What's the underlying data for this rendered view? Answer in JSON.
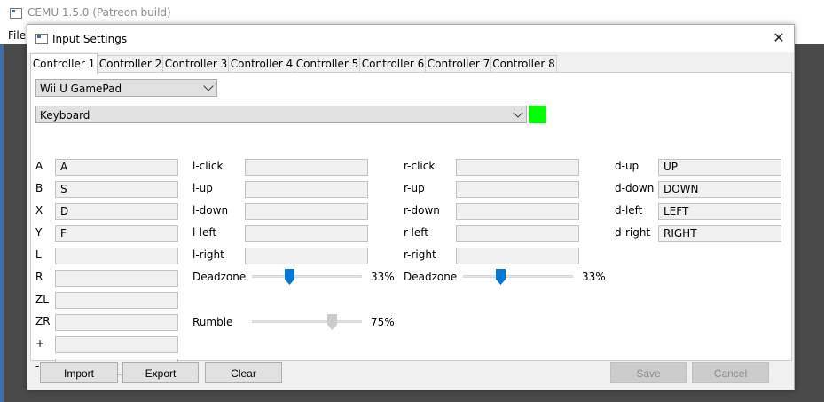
{
  "background_window": {
    "title": "CEMU 1.5.0 (Patreon build)",
    "menu_file": "File"
  },
  "dialog": {
    "title": "Input Settings",
    "close_glyph": "✕"
  },
  "tabs": [
    "Controller 1",
    "Controller 2",
    "Controller 3",
    "Controller 4",
    "Controller 5",
    "Controller 6",
    "Controller 7",
    "Controller 8"
  ],
  "active_tab": 0,
  "controller_type": "Wii U GamePad",
  "input_device": "Keyboard",
  "device_color": "#00ff00",
  "buttons": [
    {
      "label": "A",
      "value": "A"
    },
    {
      "label": "B",
      "value": "S"
    },
    {
      "label": "X",
      "value": "D"
    },
    {
      "label": "Y",
      "value": "F"
    },
    {
      "label": "L",
      "value": ""
    },
    {
      "label": "R",
      "value": ""
    },
    {
      "label": "ZL",
      "value": ""
    },
    {
      "label": "ZR",
      "value": ""
    },
    {
      "label": "+",
      "value": ""
    },
    {
      "label": "-",
      "value": ""
    }
  ],
  "left_stick": [
    {
      "label": "l-click",
      "value": ""
    },
    {
      "label": "l-up",
      "value": ""
    },
    {
      "label": "l-down",
      "value": ""
    },
    {
      "label": "l-left",
      "value": ""
    },
    {
      "label": "l-right",
      "value": ""
    }
  ],
  "right_stick": [
    {
      "label": "r-click",
      "value": ""
    },
    {
      "label": "r-up",
      "value": ""
    },
    {
      "label": "r-down",
      "value": ""
    },
    {
      "label": "r-left",
      "value": ""
    },
    {
      "label": "r-right",
      "value": ""
    }
  ],
  "dpad": [
    {
      "label": "d-up",
      "value": "UP"
    },
    {
      "label": "d-down",
      "value": "DOWN"
    },
    {
      "label": "d-left",
      "value": "LEFT"
    },
    {
      "label": "d-right",
      "value": "RIGHT"
    }
  ],
  "left_deadzone": {
    "label": "Deadzone",
    "value_text": "33%",
    "fraction": 0.33
  },
  "right_deadzone": {
    "label": "Deadzone",
    "value_text": "33%",
    "fraction": 0.33
  },
  "rumble": {
    "label": "Rumble",
    "value_text": "75%",
    "fraction": 0.75
  },
  "footer": {
    "import_label": "Import",
    "export_label": "Export",
    "clear_label": "Clear",
    "save_label": "Save",
    "cancel_label": "Cancel"
  }
}
